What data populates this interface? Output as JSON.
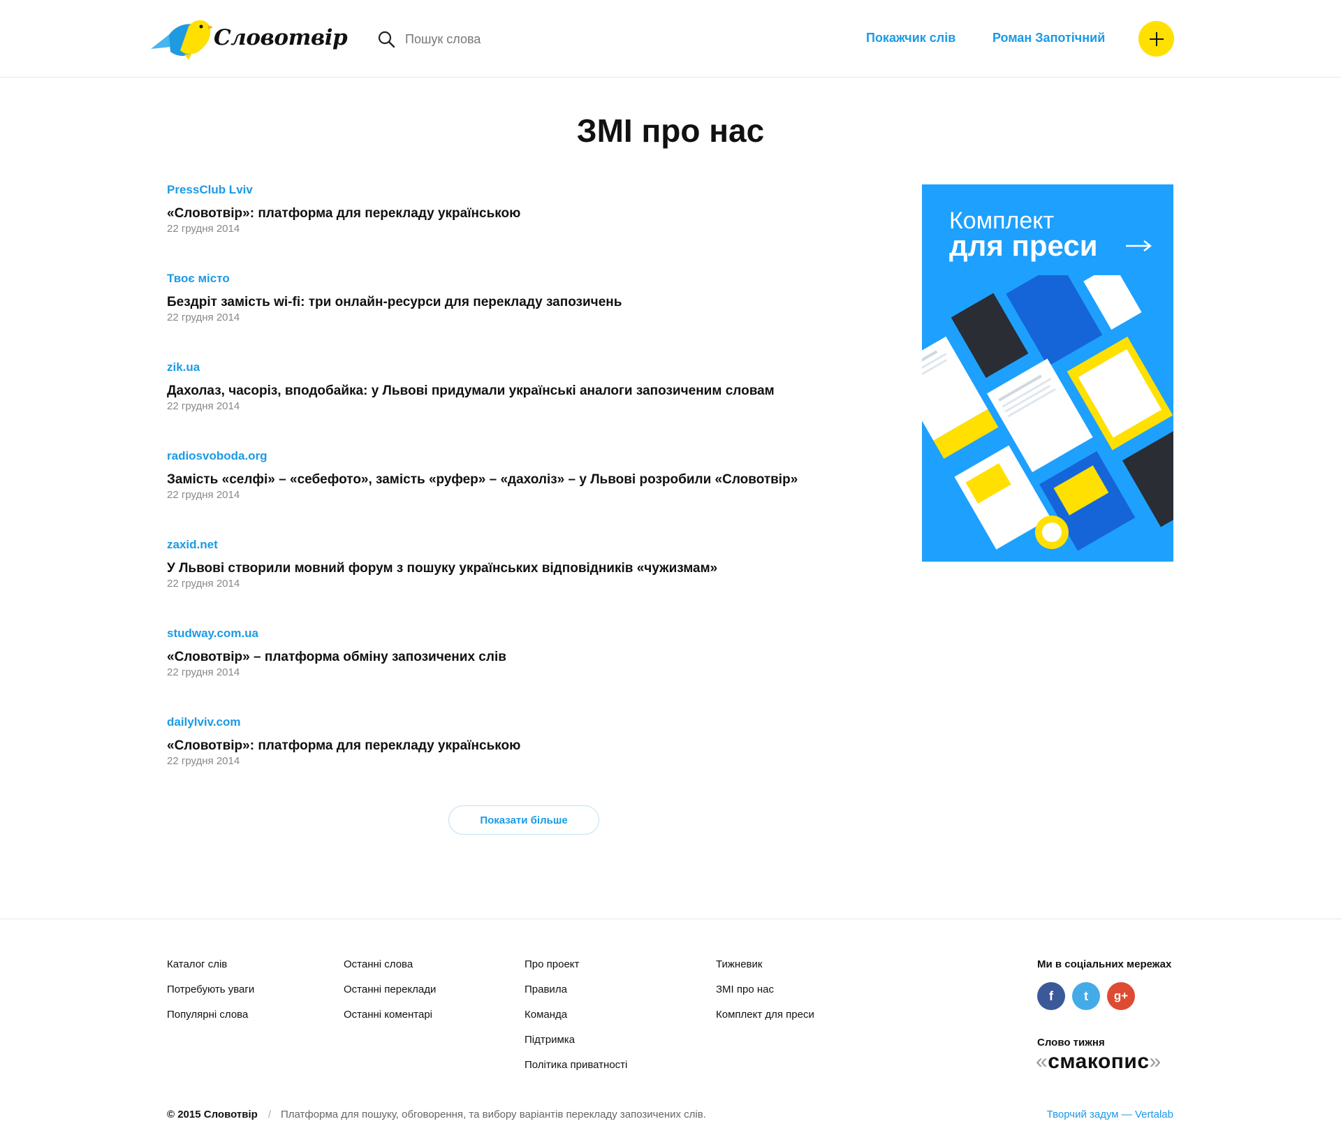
{
  "header": {
    "logo_text": "Словотвір",
    "search_placeholder": "Пошук слова",
    "nav_index": "Покажчик слів",
    "nav_user": "Роман Запотічний",
    "add_icon": "plus-icon"
  },
  "main": {
    "title": "ЗМІ про нас",
    "articles": [
      {
        "source": "PressClub Lviv",
        "title": "«Словотвір»: платформа для перекладу українською",
        "date": "22 грудня 2014"
      },
      {
        "source": "Твоє місто",
        "title": "Бездріт замість wi-fi: три онлайн-ресурси для перекладу запозичень",
        "date": "22 грудня 2014"
      },
      {
        "source": "zik.ua",
        "title": "Дахолаз, часоріз, вподобайка: у Львові придумали українські аналоги запозиченим словам",
        "date": "22 грудня 2014"
      },
      {
        "source": "radiosvoboda.org",
        "title": "Замість «селфі» – «себефото», замість «руфер» – «дахоліз» – у Львові розробили «Словотвір»",
        "date": "22 грудня 2014"
      },
      {
        "source": "zaxid.net",
        "title": "У Львові створили мовний форум з пошуку українських відповідників «чужизмам»",
        "date": "22 грудня 2014"
      },
      {
        "source": "studway.com.ua",
        "title": "«Словотвір» – платформа обміну запозичених слів",
        "date": "22 грудня 2014"
      },
      {
        "source": "dailylviv.com",
        "title": "«Словотвір»: платформа для перекладу українською",
        "date": "22 грудня 2014"
      }
    ],
    "more_button": "Показати більше"
  },
  "banner": {
    "line1": "Комплект",
    "line2": "для преси"
  },
  "footer": {
    "col1": [
      "Каталог слів",
      "Потребують уваги",
      "Популярні слова"
    ],
    "col2": [
      "Останні слова",
      "Останні переклади",
      "Останні коментарі"
    ],
    "col3": [
      "Про проект",
      "Правила",
      "Команда",
      "Підтримка",
      "Політика приватності"
    ],
    "col4": [
      "Тижневик",
      "ЗМІ про нас",
      "Комплект для преси"
    ],
    "social_title": "Ми в соціальних мережах",
    "social": [
      {
        "icon": "facebook-icon",
        "glyph": "f"
      },
      {
        "icon": "twitter-icon",
        "glyph": "t"
      },
      {
        "icon": "google-plus-icon",
        "glyph": "g+"
      }
    ],
    "word_title": "Слово тижня",
    "word_open": "«",
    "word": "смакопис",
    "word_close": "»",
    "copyright": "© 2015 Словотвір",
    "separator": "/",
    "tagline": "Платформа для пошуку, обговорення, та вибору варіантів перекладу запозичених слів.",
    "credit": "Творчий задум — Vertalab"
  },
  "colors": {
    "accent": "#1b9ae6",
    "yellow": "#ffe000",
    "banner_blue": "#1ea0ff"
  }
}
